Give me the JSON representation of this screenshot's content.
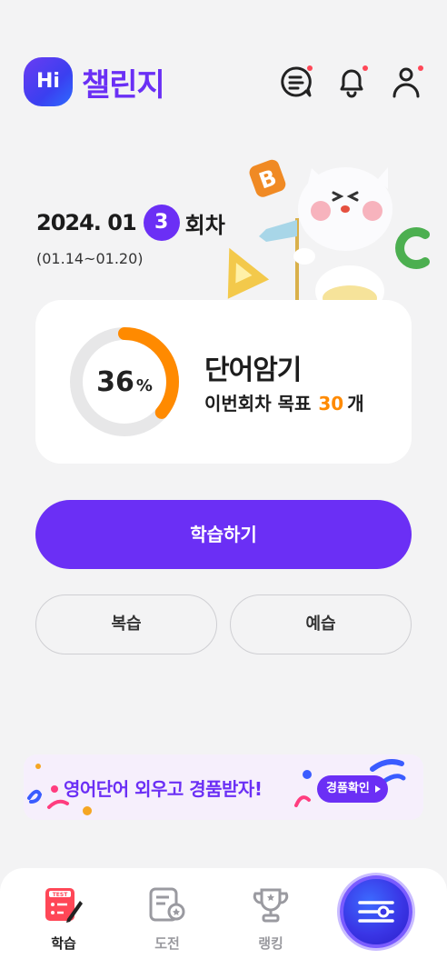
{
  "header": {
    "logo_badge": "Hi",
    "logo_text": "챌린지",
    "icons": [
      "chat-list-icon",
      "bell-icon",
      "user-icon"
    ],
    "notification_dot_color": "#ff4757"
  },
  "round": {
    "date": "2024. 01",
    "number": "3",
    "suffix": "회차",
    "range": "(01.14~01.20)"
  },
  "card": {
    "percent": "36",
    "percent_sign": "%",
    "progress": 0.36,
    "title": "단어암기",
    "goal_prefix": "이번회차 목표",
    "goal_count": "30",
    "goal_unit": "개"
  },
  "actions": {
    "main": "학습하기",
    "review": "복습",
    "preview": "예습"
  },
  "banner": {
    "text": "영어단어 외우고 경품받자!",
    "button": "경품확인"
  },
  "nav": {
    "items": [
      {
        "label": "학습",
        "icon": "test-icon",
        "active": true
      },
      {
        "label": "도전",
        "icon": "certificate-icon",
        "active": false
      },
      {
        "label": "랭킹",
        "icon": "trophy-icon",
        "active": false
      }
    ],
    "fab_icon": "settings-sliders-icon"
  },
  "colors": {
    "primary": "#6b2ff5",
    "accent": "#ff8a00",
    "background": "#f3f3f4"
  }
}
